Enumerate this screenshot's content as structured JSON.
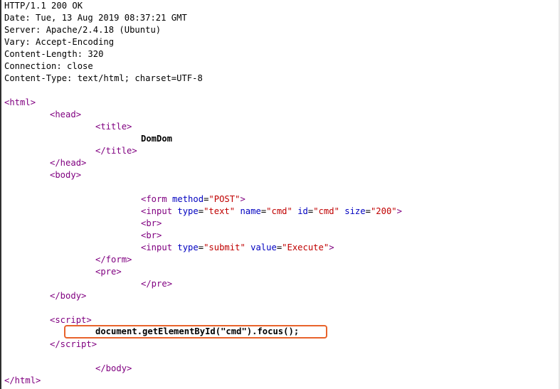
{
  "headers": [
    "HTTP/1.1 200 OK",
    "Date: Tue, 13 Aug 2019 08:37:21 GMT",
    "Server: Apache/2.4.18 (Ubuntu)",
    "Vary: Accept-Encoding",
    "Content-Length: 320",
    "Connection: close",
    "Content-Type: text/html; charset=UTF-8"
  ],
  "html": {
    "html_open": "html",
    "head_open": "head",
    "title_open": "title",
    "title_text": "DomDom",
    "title_close": "/title",
    "head_close": "/head",
    "body_open": "body",
    "form_tag": "form",
    "form_method_attr": "method",
    "form_method_val": "\"POST\"",
    "input1_tag": "input",
    "input1_type_attr": "type",
    "input1_type_val": "\"text\"",
    "input1_name_attr": "name",
    "input1_name_val": "\"cmd\"",
    "input1_id_attr": "id",
    "input1_id_val": "\"cmd\"",
    "input1_size_attr": "size",
    "input1_size_val": "\"200\"",
    "br": "br",
    "input2_tag": "input",
    "input2_type_attr": "type",
    "input2_type_val": "\"submit\"",
    "input2_value_attr": "value",
    "input2_value_val": "\"Execute\"",
    "form_close": "/form",
    "pre_open": "pre",
    "pre_close": "/pre",
    "body_close": "/body",
    "script_open": "script",
    "script_code": "document.getElementById(\"cmd\").focus();",
    "script_close": "/script",
    "html_close": "/html"
  },
  "colors": {
    "tag": "#800080",
    "attribute": "#0000c0",
    "value": "#c00000",
    "highlight": "#e8632b"
  }
}
